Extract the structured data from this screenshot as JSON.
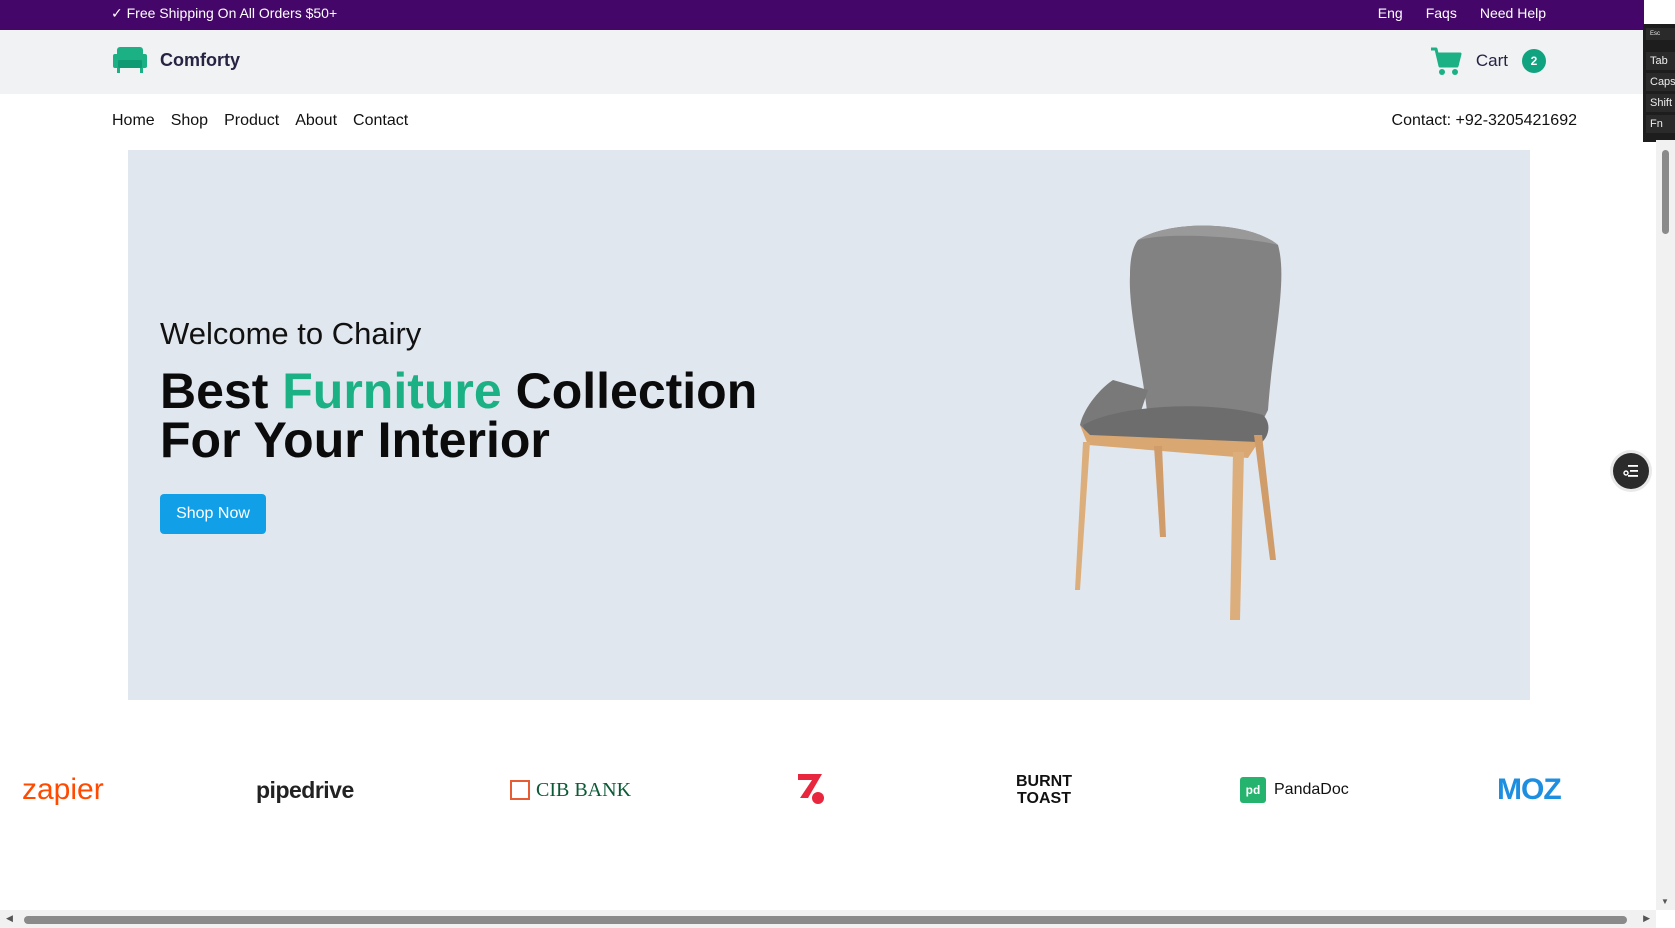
{
  "promo": {
    "shipping_text": "✓ Free Shipping On All Orders $50+",
    "links": [
      "Eng",
      "Faqs",
      "Need Help"
    ]
  },
  "header": {
    "brand_name": "Comforty",
    "logo_icon": "sofa-icon",
    "cart_icon": "cart-icon",
    "cart_label": "Cart",
    "cart_count": "2"
  },
  "nav": {
    "items": [
      "Home",
      "Shop",
      "Product",
      "About",
      "Contact"
    ],
    "contact": "Contact: +92-3205421692"
  },
  "hero": {
    "welcome": "Welcome to Chairy",
    "headline_part1": "Best ",
    "headline_accent": "Furniture",
    "headline_part2": " Collection",
    "headline_line2": "For Your Interior",
    "button_label": "Shop Now",
    "image": "chair-image"
  },
  "brands": [
    "zapier",
    "pipedrive",
    "CIB BANK",
    "Z-logo",
    "BURNT TOAST",
    "PandaDoc",
    "MOZ"
  ],
  "brand_texts": {
    "zapier": "zapier",
    "pipedrive": "pipedrive",
    "cib": "CIB BANK",
    "burnt1": "BURNT",
    "burnt2": "TOAST",
    "pandadoc": "PandaDoc",
    "moz": "MOZ"
  },
  "keyboard_overlay": [
    "Esc",
    "Tab",
    "Caps",
    "Shift",
    "Fn"
  ],
  "colors": {
    "promo_bg": "#440668",
    "accent_green": "#1bb185",
    "button_blue": "#11a0e8",
    "hero_bg": "#e1e7ef"
  }
}
